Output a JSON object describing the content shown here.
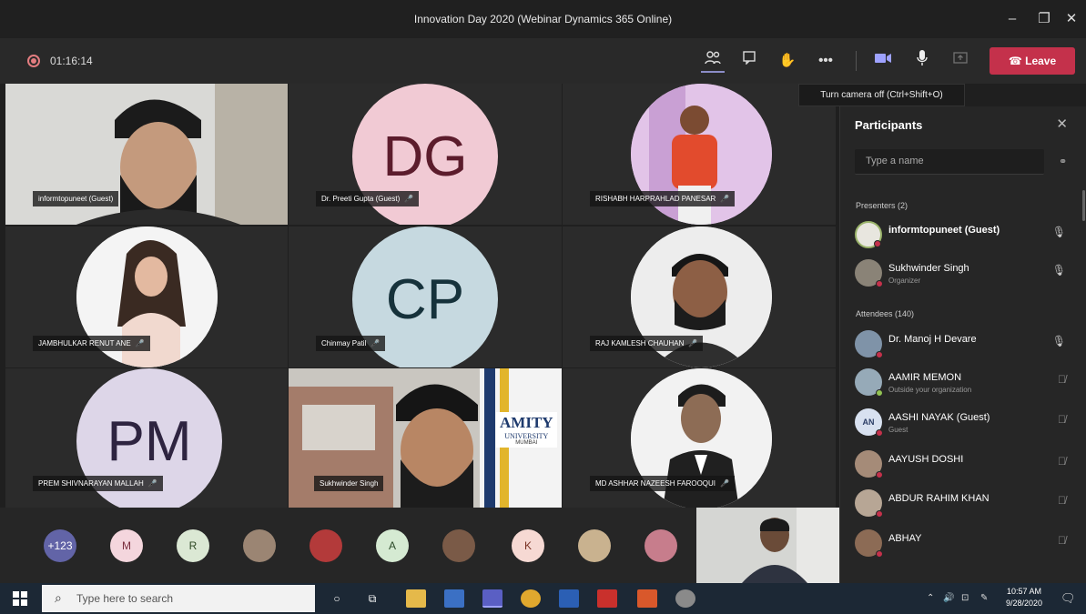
{
  "window": {
    "title": "Innovation Day 2020 (Webinar Dynamics 365 Online)"
  },
  "meeting": {
    "timer": "01:16:14",
    "leave_label": "Leave",
    "tooltip": "Turn camera off (Ctrl+Shift+O)"
  },
  "tiles": [
    {
      "name": "informtopuneet (Guest)",
      "kind": "video"
    },
    {
      "name": "Dr. Preeti Gupta (Guest)",
      "initials": "DG",
      "color": "#f1cad4",
      "text_color": "#5c1c2c"
    },
    {
      "name": "RISHABH HARPRAHLAD PANESAR",
      "kind": "photo"
    },
    {
      "name": "JAMBHULKAR RENUT ANE",
      "kind": "photo"
    },
    {
      "name": "Chinmay Patil",
      "initials": "CP",
      "color": "#c6d9e0",
      "text_color": "#16323b"
    },
    {
      "name": "RAJ KAMLESH CHAUHAN",
      "kind": "photo"
    },
    {
      "name": "PREM SHIVNARAYAN MALLAH",
      "initials": "PM",
      "color": "#ddd6e8",
      "text_color": "#2e2440"
    },
    {
      "name": "Sukhwinder Singh",
      "kind": "video",
      "banner": "AMITY",
      "banner_sub": "UNIVERSITY",
      "banner_city": "MUMBAI"
    },
    {
      "name": "MD ASHHAR NAZEESH FAROOQUI",
      "kind": "photo"
    }
  ],
  "strip": [
    {
      "label": "+123",
      "color": "#6264a7",
      "text": "#fff"
    },
    {
      "label": "M",
      "color": "#f4d6dd",
      "text": "#7a2d3d"
    },
    {
      "label": "R",
      "color": "#dbe8d4",
      "text": "#2f4a25"
    },
    {
      "label": "",
      "color": "#9b8573",
      "text": "#fff"
    },
    {
      "label": "",
      "color": "#b33a3a",
      "text": "#fff"
    },
    {
      "label": "A",
      "color": "#d5ead2",
      "text": "#2b4a28"
    },
    {
      "label": "",
      "color": "#7a5a47",
      "text": "#fff"
    },
    {
      "label": "K",
      "color": "#f6d9d3",
      "text": "#7a3325"
    },
    {
      "label": "",
      "color": "#c9b28f",
      "text": "#fff"
    },
    {
      "label": "",
      "color": "#c77d8c",
      "text": "#fff"
    }
  ],
  "panel": {
    "title": "Participants",
    "search_placeholder": "Type a name",
    "presenters_header": "Presenters (2)",
    "attendees_header": "Attendees (140)",
    "presenters": [
      {
        "name": "informtopuneet (Guest)",
        "sub": "",
        "initials": "",
        "color": "#e8e6df"
      },
      {
        "name": "Sukhwinder Singh",
        "sub": "Organizer",
        "initials": "",
        "color": "#8a8377"
      }
    ],
    "attendees": [
      {
        "name": "Dr. Manoj H Devare",
        "sub": "",
        "initials": "",
        "color": "#7f93a8"
      },
      {
        "name": "AAMIR MEMON",
        "sub": "Outside your organization",
        "initials": "",
        "color": "#96aab8"
      },
      {
        "name": "AASHI NAYAK (Guest)",
        "sub": "Guest",
        "initials": "AN",
        "color": "#d8e1f0"
      },
      {
        "name": "AAYUSH DOSHI",
        "sub": "",
        "initials": "",
        "color": "#a58b78"
      },
      {
        "name": "ABDUR RAHIM KHAN",
        "sub": "",
        "initials": "",
        "color": "#b7a695"
      },
      {
        "name": "ABHAY",
        "sub": "",
        "initials": "",
        "color": "#8c6b55"
      }
    ]
  },
  "taskbar": {
    "search_placeholder": "Type here to search",
    "time": "10:57 AM",
    "date": "9/28/2020"
  },
  "icons": {
    "participants": "people-icon",
    "chat": "chat-icon",
    "raise_hand": "hand-icon",
    "more": "more-icon",
    "camera": "camera-icon",
    "mic": "mic-icon",
    "share": "share-icon"
  }
}
